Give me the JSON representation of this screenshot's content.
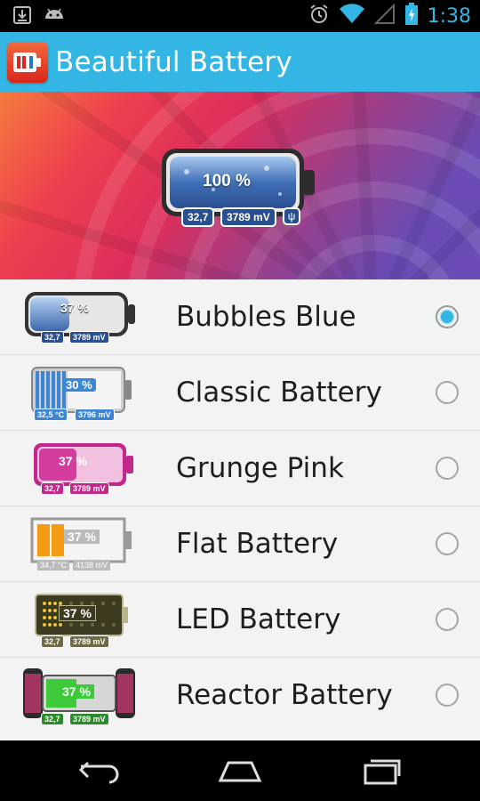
{
  "status_bar": {
    "time": "1:38",
    "icons": [
      "download-icon",
      "android-icon",
      "alarm-icon",
      "wifi-icon",
      "signal-icon",
      "battery-charging-icon"
    ]
  },
  "action_bar": {
    "title": "Beautiful Battery",
    "icon": "battery-app-icon"
  },
  "hero": {
    "percent": "100 %",
    "temperature": "32,7",
    "voltage": "3789 mV",
    "plug_icon": "usb-icon"
  },
  "themes": [
    {
      "name": "Bubbles Blue",
      "percent": "37 %",
      "temp": "32,7",
      "voltage": "3789 mV",
      "selected": true
    },
    {
      "name": "Classic Battery",
      "percent": "30 %",
      "temp": "32,5 °C",
      "voltage": "3796 mV",
      "selected": false
    },
    {
      "name": "Grunge Pink",
      "percent": "37 %",
      "temp": "32,7",
      "voltage": "3789 mV",
      "selected": false
    },
    {
      "name": "Flat Battery",
      "percent": "37 %",
      "temp": "34,7 °C",
      "voltage": "4138 mV",
      "selected": false
    },
    {
      "name": "LED Battery",
      "percent": "37 %",
      "temp": "32,7",
      "voltage": "3789 mV",
      "selected": false
    },
    {
      "name": "Reactor Battery",
      "percent": "37 %",
      "temp": "32,7",
      "voltage": "3789 mV",
      "selected": false
    }
  ],
  "nav_bar": {
    "buttons": [
      "back-icon",
      "home-icon",
      "recents-icon"
    ]
  },
  "colors": {
    "accent": "#33b5e5",
    "action_bar": "#34b6e4"
  }
}
